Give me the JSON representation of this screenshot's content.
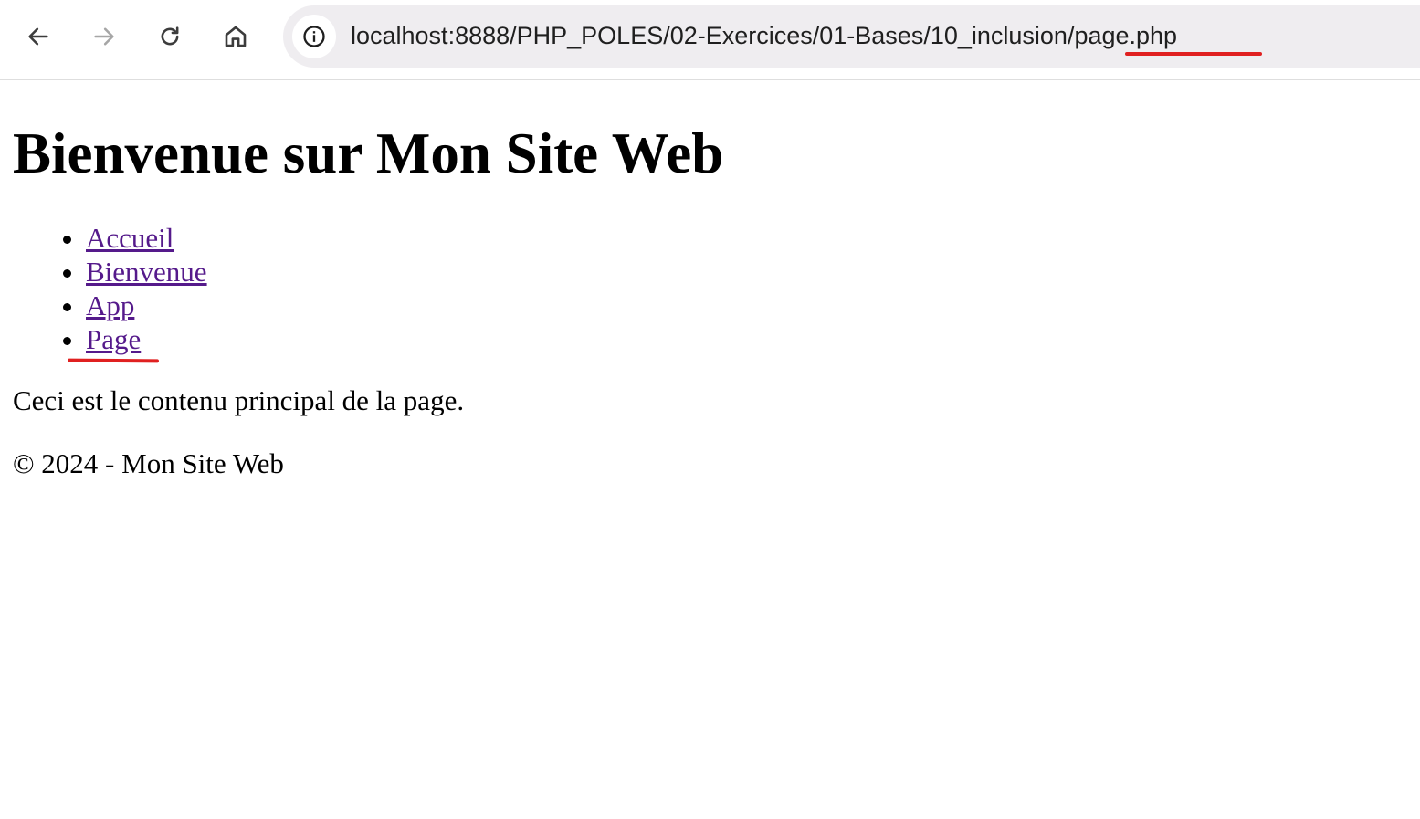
{
  "browser": {
    "url": "localhost:8888/PHP_POLES/02-Exercices/01-Bases/10_inclusion/page.php",
    "buttons": {
      "back_icon": "arrow-left",
      "forward_icon": "arrow-right",
      "reload_icon": "reload",
      "home_icon": "home",
      "site_info_icon": "info-circle"
    },
    "highlight_color": "#e02020"
  },
  "page": {
    "title": "Bienvenue sur Mon Site Web",
    "nav": [
      {
        "label": "Accueil"
      },
      {
        "label": "Bienvenue"
      },
      {
        "label": "App"
      },
      {
        "label": "Page"
      }
    ],
    "main_text": "Ceci est le contenu principal de la page.",
    "footer": "© 2024 - Mon Site Web",
    "link_color": "#551a8b"
  }
}
